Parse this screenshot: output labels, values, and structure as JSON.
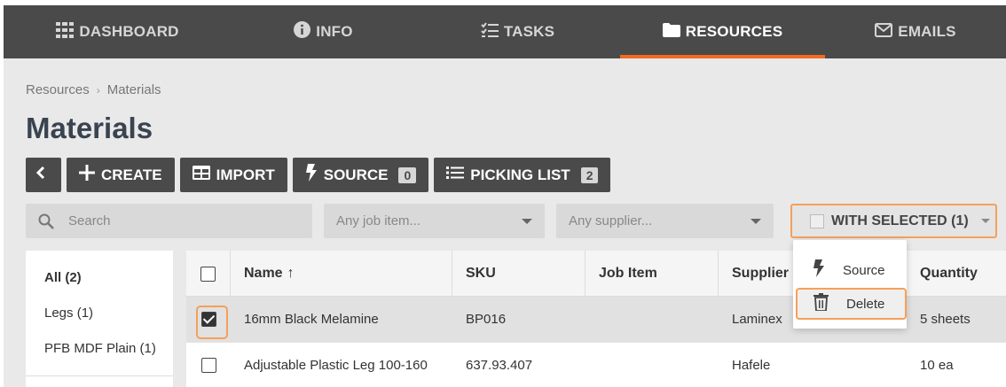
{
  "nav": {
    "tabs": [
      {
        "label": "DASHBOARD",
        "icon": "grid-icon"
      },
      {
        "label": "INFO",
        "icon": "info-icon"
      },
      {
        "label": "TASKS",
        "icon": "tasks-icon"
      },
      {
        "label": "RESOURCES",
        "icon": "folder-icon",
        "active": true
      },
      {
        "label": "EMAILS",
        "icon": "envelope-icon"
      }
    ]
  },
  "breadcrumb": [
    "Resources",
    "Materials"
  ],
  "page_title": "Materials",
  "toolbar": {
    "create_label": "CREATE",
    "import_label": "IMPORT",
    "source_label": "SOURCE",
    "source_count": "0",
    "picking_label": "PICKING LIST",
    "picking_count": "2"
  },
  "filters": {
    "search_placeholder": "Search",
    "job_item_placeholder": "Any job item...",
    "supplier_placeholder": "Any supplier..."
  },
  "with_selected": {
    "label": "WITH SELECTED (1)",
    "menu": [
      "Source",
      "Delete"
    ]
  },
  "sidebar": {
    "items": [
      "All (2)",
      "Legs (1)",
      "PFB MDF Plain (1)"
    ]
  },
  "table": {
    "columns": [
      "Name",
      "SKU",
      "Job Item",
      "Supplier",
      "Quantity"
    ],
    "sort_indicator": "↑",
    "rows": [
      {
        "name": "16mm Black Melamine",
        "sku": "BP016",
        "job_item": "",
        "supplier": "Laminex",
        "quantity": "5 sheets",
        "selected": true
      },
      {
        "name": "Adjustable Plastic Leg 100-160",
        "sku": "637.93.407",
        "job_item": "",
        "supplier": "Hafele",
        "quantity": "10 ea",
        "selected": false
      }
    ]
  },
  "colors": {
    "accent": "#f26b21",
    "nav_bg": "#4a4a4a",
    "highlight": "#f5a05a"
  }
}
